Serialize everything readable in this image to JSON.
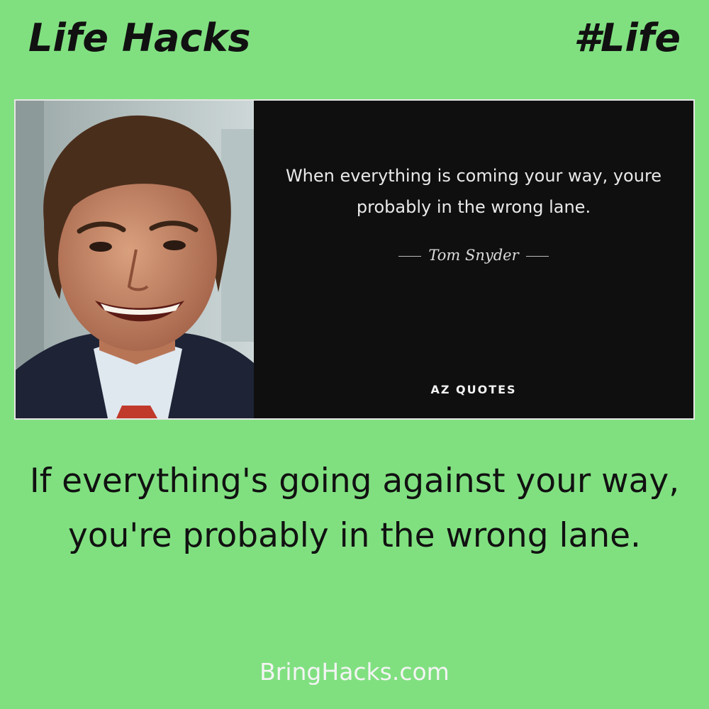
{
  "header": {
    "brand": "Life Hacks",
    "tag": "#Life"
  },
  "quote_card": {
    "quote": "When everything is coming your way, youre probably in the wrong lane.",
    "author": "Tom Snyder",
    "logo": "AZ QUOTES"
  },
  "caption": "If everything's going against your way, you're probably in the wrong lane.",
  "footer": {
    "site": "BringHacks.com"
  },
  "colors": {
    "background": "#80e080",
    "card": "#0f0f0f"
  }
}
